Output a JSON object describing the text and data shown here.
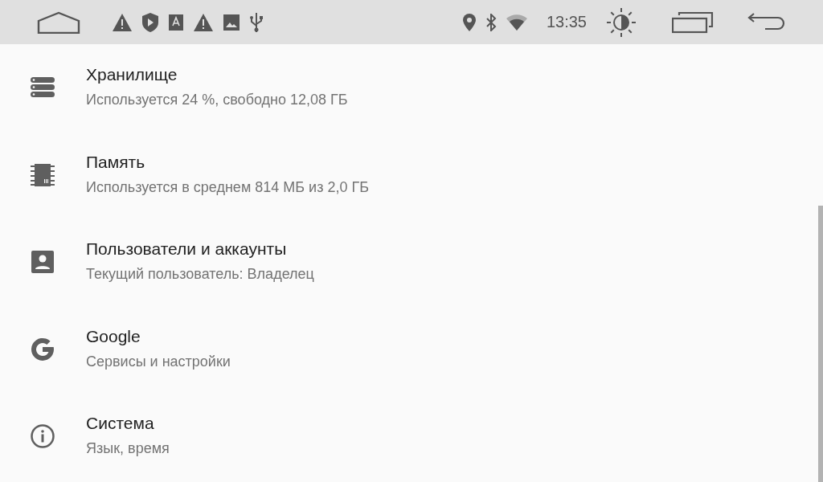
{
  "status_bar": {
    "time": "13:35"
  },
  "settings": [
    {
      "kind": "storage",
      "title": "Хранилище",
      "summary": "Используется 24 %, свободно 12,08 ГБ"
    },
    {
      "kind": "memory",
      "title": "Память",
      "summary": "Используется в среднем 814 МБ из 2,0 ГБ"
    },
    {
      "kind": "accounts",
      "title": "Пользователи и аккаунты",
      "summary": "Текущий пользователь: Владелец"
    },
    {
      "kind": "google",
      "title": "Google",
      "summary": "Сервисы и настройки"
    },
    {
      "kind": "system",
      "title": "Система",
      "summary": "Язык, время"
    }
  ]
}
